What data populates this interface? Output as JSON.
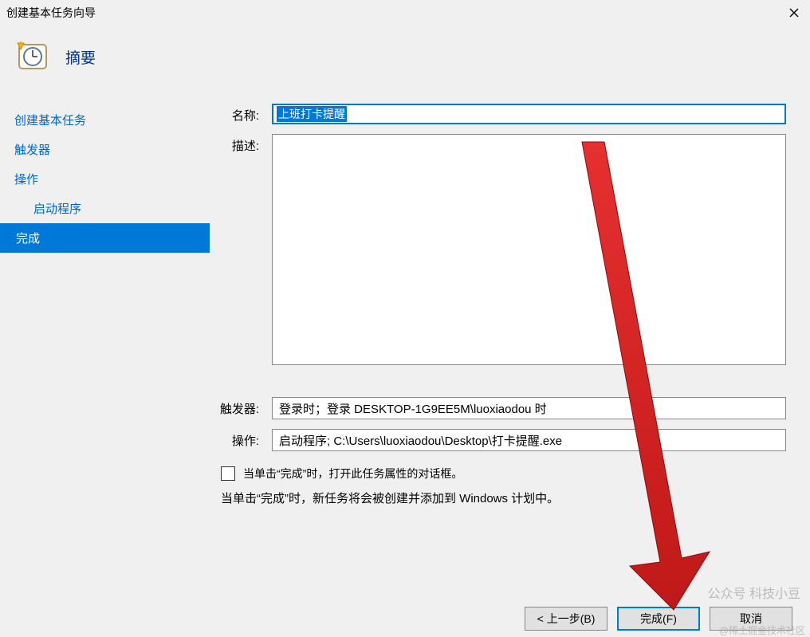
{
  "titlebar": {
    "title": "创建基本任务向导"
  },
  "header": {
    "heading": "摘要"
  },
  "sidebar": {
    "items": [
      {
        "label": "创建基本任务",
        "indent": false
      },
      {
        "label": "触发器",
        "indent": false
      },
      {
        "label": "操作",
        "indent": false
      },
      {
        "label": "启动程序",
        "indent": true
      },
      {
        "label": "完成",
        "indent": false,
        "active": true
      }
    ]
  },
  "form": {
    "name_label": "名称:",
    "name_value": "上班打卡提醒",
    "desc_label": "描述:",
    "trigger_label": "触发器:",
    "trigger_value": "登录时；登录 DESKTOP-1G9EE5M\\luoxiaodou 时",
    "action_label": "操作:",
    "action_value": "启动程序; C:\\Users\\luoxiaodou\\Desktop\\打卡提醒.exe",
    "checkbox_label": "当单击“完成”时，打开此任务属性的对话框。",
    "info_text": "当单击“完成”时，新任务将会被创建并添加到 Windows 计划中。"
  },
  "buttons": {
    "back": "< 上一步(B)",
    "finish": "完成(F)",
    "cancel": "取消"
  },
  "watermark": "公众号 科技小豆",
  "watermark2": "@稀土掘金技术社区"
}
